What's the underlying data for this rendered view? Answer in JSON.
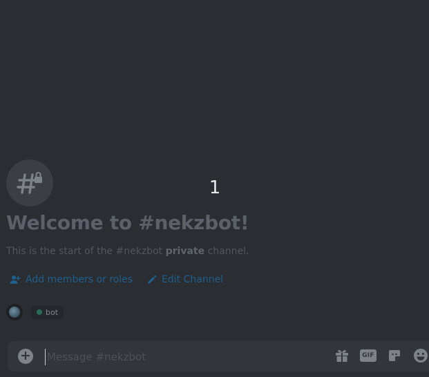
{
  "overlay": {
    "countdown": "1"
  },
  "channel": {
    "icon": "hash-lock-icon",
    "welcome_title": "Welcome to #nekzbot!",
    "intro_prefix": "This is the start of the #nekzbot ",
    "intro_bold": "private",
    "intro_suffix": " channel."
  },
  "actions": {
    "add_members_label": "Add members or roles",
    "add_members_icon": "add-user-icon",
    "edit_channel_label": "Edit Channel",
    "edit_channel_icon": "pencil-icon"
  },
  "members": {
    "role_label": "bot",
    "role_color": "#2a6b57"
  },
  "composer": {
    "placeholder": "Message #nekzbot",
    "value": "",
    "tools": [
      "gift-icon",
      "gif-button",
      "sticker-icon",
      "emoji-icon"
    ],
    "gif_label": "GIF"
  },
  "colors": {
    "background": "#2a2d32",
    "link": "#1f5f8c",
    "composer_bg": "#32353b"
  }
}
